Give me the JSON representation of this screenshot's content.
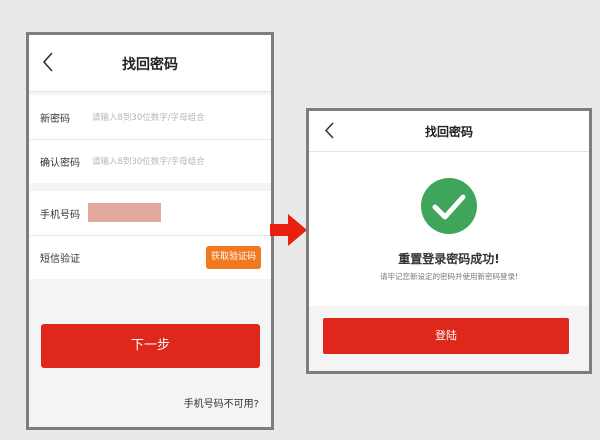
{
  "left_screen": {
    "title": "找回密码",
    "new_password": {
      "label": "新密码",
      "placeholder": "请输入8到30位数字/字母组合"
    },
    "confirm_password": {
      "label": "确认密码",
      "placeholder": "请输入8到30位数字/字母组合"
    },
    "phone_number": {
      "label": "手机号码"
    },
    "sms_code": {
      "label": "短信验证",
      "button_label": "获取验证码"
    },
    "next_button_label": "下一步",
    "phone_unavailable_link": "手机号码不可用?"
  },
  "right_screen": {
    "title": "找回密码",
    "success_title": "重置登录密码成功!",
    "success_subtitle": "请牢记您新设定的密码并使用新密码登录!",
    "login_button_label": "登陆"
  },
  "colors": {
    "primary_red": "#e0271b",
    "sms_orange": "#f0781f",
    "success_green": "#3ea55a",
    "masked_value": "#e3ab9e",
    "arrow_red": "#e8210f"
  },
  "icons": {
    "back": "chevron-left-icon",
    "success": "check-circle-icon",
    "flow_arrow": "arrow-right-icon"
  }
}
